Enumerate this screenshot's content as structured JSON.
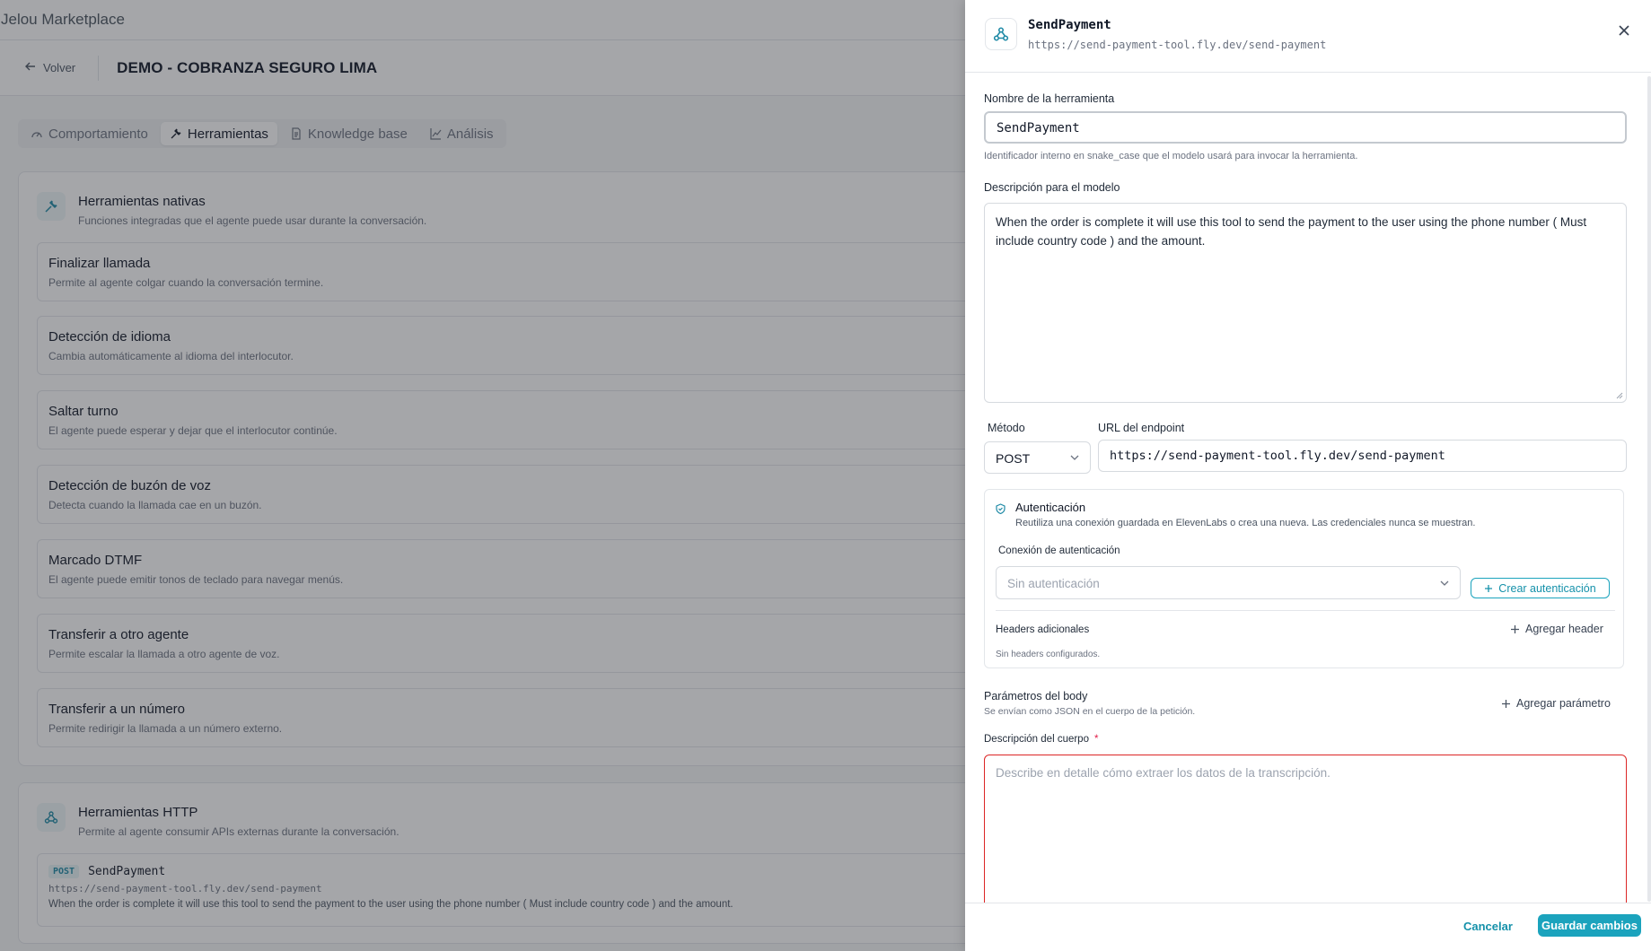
{
  "app": {
    "brand": "Jelou Marketplace"
  },
  "header": {
    "back_label": "Volver",
    "title": "DEMO - COBRANZA SEGURO LIMA"
  },
  "tabs": [
    {
      "label": "Comportamiento",
      "icon": "gauge-icon",
      "active": false
    },
    {
      "label": "Herramientas",
      "icon": "wrench-icon",
      "active": true
    },
    {
      "label": "Knowledge base",
      "icon": "document-icon",
      "active": false
    },
    {
      "label": "Análisis",
      "icon": "chart-icon",
      "active": false
    }
  ],
  "native_tools": {
    "title": "Herramientas nativas",
    "subtitle": "Funciones integradas que el agente puede usar durante la conversación.",
    "items": [
      {
        "title": "Finalizar llamada",
        "desc": "Permite al agente colgar cuando la conversación termine."
      },
      {
        "title": "Detección de idioma",
        "desc": "Cambia automáticamente al idioma del interlocutor."
      },
      {
        "title": "Saltar turno",
        "desc": "El agente puede esperar y dejar que el interlocutor continúe."
      },
      {
        "title": "Detección de buzón de voz",
        "desc": "Detecta cuando la llamada cae en un buzón."
      },
      {
        "title": "Marcado DTMF",
        "desc": "El agente puede emitir tonos de teclado para navegar menús."
      },
      {
        "title": "Transferir a otro agente",
        "desc": "Permite escalar la llamada a otro agente de voz."
      },
      {
        "title": "Transferir a un número",
        "desc": "Permite redirigir la llamada a un número externo."
      }
    ]
  },
  "http_tools": {
    "title": "Herramientas HTTP",
    "subtitle": "Permite al agente consumir APIs externas durante la conversación.",
    "item": {
      "method": "POST",
      "name": "SendPayment",
      "url": "https://send-payment-tool.fly.dev/send-payment",
      "desc": "When the order is complete it will use this tool to send the payment to the user using the phone number ( Must include country code ) and the amount."
    }
  },
  "drawer": {
    "title": "SendPayment",
    "url": "https://send-payment-tool.fly.dev/send-payment",
    "name_label": "Nombre de la herramienta",
    "name_value": "SendPayment",
    "name_hint": "Identificador interno en snake_case que el modelo usará para invocar la herramienta.",
    "desc_label": "Descripción para el modelo",
    "desc_value": "When the order is complete it will use this tool to send the payment to the user using the phone number ( Must include country code ) and the amount.",
    "method_label": "Método",
    "method_value": "POST",
    "endpoint_label": "URL del endpoint",
    "endpoint_value": "https://send-payment-tool.fly.dev/send-payment",
    "auth": {
      "title": "Autenticación",
      "desc": "Reutiliza una conexión guardada en ElevenLabs o crea una nueva. Las credenciales nunca se muestran.",
      "connection_label": "Conexión de autenticación",
      "connection_value": "Sin autenticación",
      "create_label": "Crear autenticación",
      "headers_label": "Headers adicionales",
      "add_header_label": "Agregar header",
      "no_headers": "Sin headers configurados."
    },
    "body": {
      "title": "Parámetros del body",
      "subtitle": "Se envían como JSON en el cuerpo de la petición.",
      "add_param_label": "Agregar parámetro",
      "desc_label": "Descripción del cuerpo",
      "required_mark": "*",
      "desc_placeholder": "Describe en detalle cómo extraer los datos de la transcripción."
    },
    "footer": {
      "cancel": "Cancelar",
      "save": "Guardar cambios"
    }
  },
  "colors": {
    "accent": "#1ba3bd",
    "error": "#dc2626"
  }
}
